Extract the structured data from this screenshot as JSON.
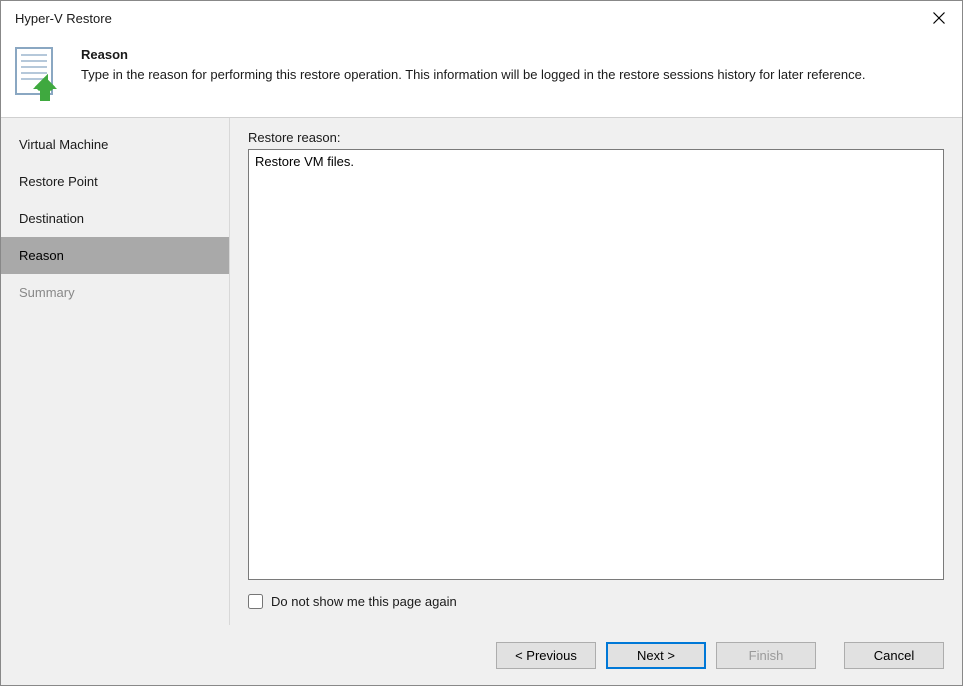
{
  "window": {
    "title": "Hyper-V Restore"
  },
  "header": {
    "title": "Reason",
    "description": "Type in the reason for performing this restore operation. This information will be logged in the restore sessions history for later reference."
  },
  "sidebar": {
    "items": [
      {
        "label": "Virtual Machine",
        "state": "normal"
      },
      {
        "label": "Restore Point",
        "state": "normal"
      },
      {
        "label": "Destination",
        "state": "normal"
      },
      {
        "label": "Reason",
        "state": "selected"
      },
      {
        "label": "Summary",
        "state": "disabled"
      }
    ]
  },
  "main": {
    "field_label": "Restore reason:",
    "reason_value": "Restore VM files.",
    "checkbox_label": "Do not show me this page again",
    "checkbox_checked": false
  },
  "footer": {
    "previous_label": "< Previous",
    "next_label": "Next >",
    "finish_label": "Finish",
    "cancel_label": "Cancel"
  }
}
